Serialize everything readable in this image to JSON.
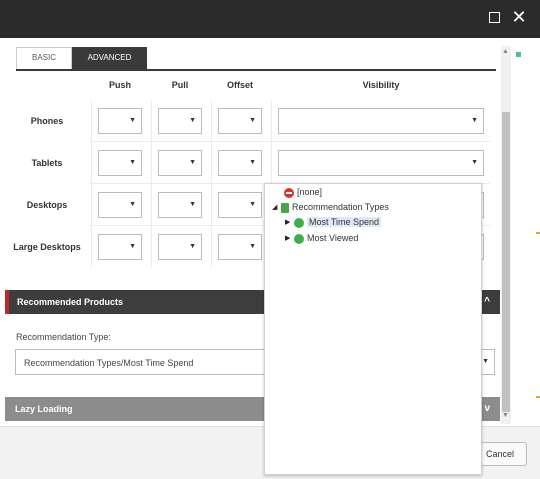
{
  "window": {
    "maximize_icon": "maximize-icon",
    "close_icon": "close-icon",
    "close_glyph": "✕"
  },
  "tabs": [
    {
      "label": "BASIC",
      "active": false
    },
    {
      "label": "ADVANCED",
      "active": true
    }
  ],
  "grid": {
    "columns": [
      "Push",
      "Pull",
      "Offset",
      "Visibility"
    ],
    "rows": [
      "Phones",
      "Tablets",
      "Desktops",
      "Large Desktops"
    ]
  },
  "sections": {
    "recommended": {
      "title": "Recommended Products",
      "accent": "#c0262c"
    },
    "lazy": {
      "title": "Lazy Loading"
    }
  },
  "recommendation": {
    "label": "Recommendation Type:",
    "value": "Recommendation Types/Most Time Spend"
  },
  "tree": {
    "items": [
      {
        "label": "[none]",
        "icon": "none-icon"
      },
      {
        "label": "Recommendation Types",
        "icon": "folder-book-icon",
        "expanded": true
      },
      {
        "label": "Most Time Spend",
        "icon": "item-icon",
        "selected": true
      },
      {
        "label": "Most Viewed",
        "icon": "item-icon"
      }
    ]
  },
  "footer": {
    "cancel_label": "Cancel"
  },
  "glyphs": {
    "dropdown": "▼",
    "chevron_up": "^",
    "chevron_down": "v",
    "expanded": "◢",
    "collapsed": "▶",
    "scroll_up": "▲",
    "scroll_down": "▼"
  }
}
